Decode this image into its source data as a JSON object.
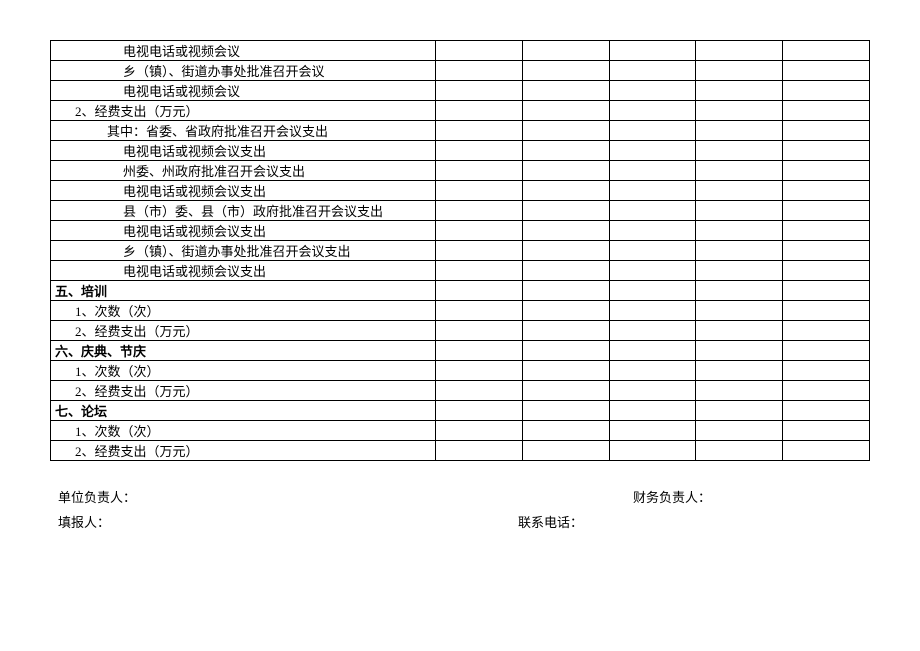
{
  "rows": [
    {
      "label": "电视电话或视频会议",
      "indent": 3
    },
    {
      "label": "乡（镇）、街道办事处批准召开会议",
      "indent": 3
    },
    {
      "label": "电视电话或视频会议",
      "indent": 3
    },
    {
      "label": "2、经费支出（万元）",
      "indent": 1
    },
    {
      "label": "其中：省委、省政府批准召开会议支出",
      "indent": 2
    },
    {
      "label": "电视电话或视频会议支出",
      "indent": 3
    },
    {
      "label": "州委、州政府批准召开会议支出",
      "indent": 3
    },
    {
      "label": "电视电话或视频会议支出",
      "indent": 3
    },
    {
      "label": "县（市）委、县（市）政府批准召开会议支出",
      "indent": 3
    },
    {
      "label": "电视电话或视频会议支出",
      "indent": 3
    },
    {
      "label": "乡（镇）、街道办事处批准召开会议支出",
      "indent": 3
    },
    {
      "label": "电视电话或视频会议支出",
      "indent": 3
    },
    {
      "label": "五、培训",
      "indent": 0,
      "section": true
    },
    {
      "label": "1、次数（次）",
      "indent": 1
    },
    {
      "label": "2、经费支出（万元）",
      "indent": 1
    },
    {
      "label": "六、庆典、节庆",
      "indent": 0,
      "section": true
    },
    {
      "label": "1、次数（次）",
      "indent": 1
    },
    {
      "label": "2、经费支出（万元）",
      "indent": 1
    },
    {
      "label": "七、论坛",
      "indent": 0,
      "section": true
    },
    {
      "label": "1、次数（次）",
      "indent": 1
    },
    {
      "label": "2、经费支出（万元）",
      "indent": 1
    }
  ],
  "footer": {
    "unit_leader": "单位负责人：",
    "finance_leader": "财务负责人：",
    "filler": "填报人：",
    "phone": "联系电话："
  }
}
